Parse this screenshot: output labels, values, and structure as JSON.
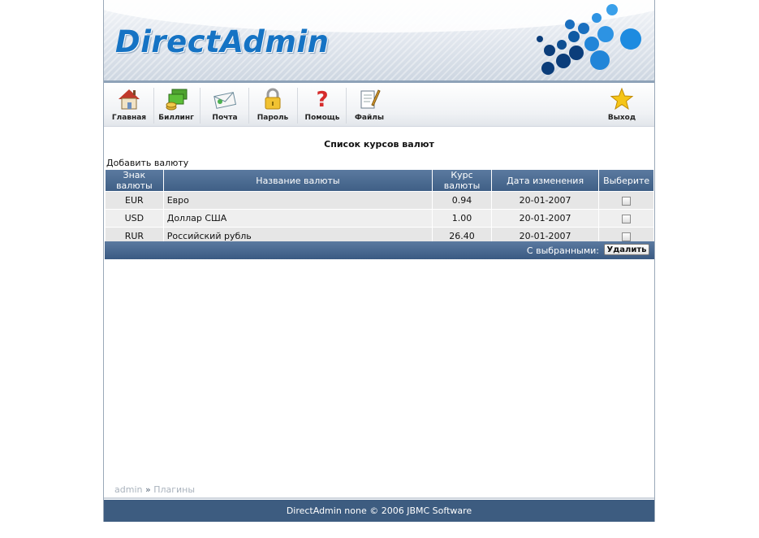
{
  "brand": {
    "logo_text": "DirectAdmin",
    "accent": "#1573c4",
    "bar_color": "#3d5c80"
  },
  "toolbar": {
    "items": [
      {
        "label": "Главная",
        "icon": "home-icon"
      },
      {
        "label": "Биллинг",
        "icon": "billing-icon"
      },
      {
        "label": "Почта",
        "icon": "mail-icon"
      },
      {
        "label": "Пароль",
        "icon": "lock-icon"
      },
      {
        "label": "Помощь",
        "icon": "help-icon"
      },
      {
        "label": "Файлы",
        "icon": "files-icon"
      }
    ],
    "logout": {
      "label": "Выход",
      "icon": "star-icon"
    }
  },
  "page": {
    "title": "Список курсов валют",
    "add_link": "Добавить валюту"
  },
  "table": {
    "headers": [
      "Знак валюты",
      "Название валюты",
      "Курс валюты",
      "Дата изменения",
      "Выберите"
    ],
    "rows": [
      {
        "code": "EUR",
        "name": "Евро",
        "rate": "0.94",
        "date": "20-01-2007"
      },
      {
        "code": "USD",
        "name": "Доллар США",
        "rate": "1.00",
        "date": "20-01-2007"
      },
      {
        "code": "RUR",
        "name": "Российский рубль",
        "rate": "26.40",
        "date": "20-01-2007"
      }
    ],
    "with_selected": "С выбранными:",
    "delete_label": "Удалить"
  },
  "breadcrumb": {
    "user": "admin",
    "sep": "»",
    "section": "Плагины"
  },
  "footer": {
    "copyright": "DirectAdmin none © 2006 JBMC Software"
  }
}
